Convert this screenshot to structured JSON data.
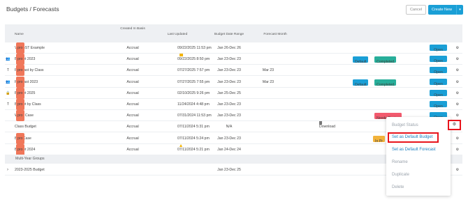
{
  "page": {
    "title": "Budgets / Forecasts",
    "cancel_label": "Cancel",
    "create_label": "Create New",
    "create_caret": "▾"
  },
  "columns": {
    "name": "Name",
    "basis": "Created In Basis",
    "updated": "Last Updated",
    "range": "Budget Date Range",
    "forecast": "Forecast Month"
  },
  "pro_label": "pro",
  "open_label": "Open",
  "gear_glyph": "⚙",
  "download_label": "Download",
  "rows": [
    {
      "name": "VAT/GST Example",
      "pro": true,
      "basis": "Accrual",
      "updated": "09/22/2025 11:53 pm",
      "range": "Jan 26-Dec 26",
      "forecast": "",
      "icon": ""
    },
    {
      "name": "Budget 2023",
      "pro": true,
      "basis": "Accrual",
      "updated": "09/22/2025 8:50 pm",
      "range": "Jan 23-Dec 23",
      "forecast": "",
      "icon": "people-icon",
      "badges": [
        "Default",
        "Completed"
      ]
    },
    {
      "name": "Forecast by Class",
      "pro": true,
      "basis": "Accrual",
      "updated": "07/27/2025 7:57 pm",
      "range": "Jan 23-Dec 23",
      "forecast": "Mar 23",
      "icon": "class-icon"
    },
    {
      "name": "Forecast 2023",
      "pro": true,
      "basis": "Accrual",
      "updated": "07/27/2025 7:55 pm",
      "range": "Jan 23-Dec 23",
      "forecast": "Mar 23",
      "icon": "people-icon",
      "badges": [
        "Default",
        "Completed"
      ]
    },
    {
      "name": "Budget 2025",
      "pro": true,
      "basis": "Accrual",
      "updated": "02/10/2025 9:26 pm",
      "range": "Jan 25-Dec 25",
      "forecast": "",
      "icon": "lock-icon"
    },
    {
      "name": "Budget by Class",
      "pro": true,
      "basis": "Accrual",
      "updated": "11/24/2024 4:48 pm",
      "range": "Jan 23-Dec 23",
      "forecast": "",
      "icon": "class-icon"
    },
    {
      "name": "Worst Case",
      "pro": true,
      "basis": "Accrual",
      "updated": "07/31/2024 11:53 pm",
      "range": "Jan 23-Dec 23",
      "forecast": "",
      "icon": "",
      "badges": [
        "Needs Review"
      ]
    },
    {
      "name": "Class Budget",
      "pro": false,
      "basis": "Accrual",
      "updated": "07/11/2024 5:31 pm",
      "range": "N/A",
      "forecast": "",
      "icon": ""
    },
    {
      "name": "Best Case",
      "pro": true,
      "basis": "Accrual",
      "updated": "07/11/2024 5:24 pm",
      "range": "Jan 23-Dec 23",
      "forecast": "",
      "icon": "",
      "badges": [
        "In Pr"
      ]
    },
    {
      "name": "Budget 2024",
      "pro": true,
      "basis": "Accrual",
      "updated": "07/11/2024 5:21 pm",
      "range": "Jan 24-Dec 24",
      "forecast": "",
      "icon": ""
    }
  ],
  "group": {
    "label": "Multi-Year Groups",
    "row": {
      "name": "2023-2025 Budget",
      "range": "Jan 23-Dec 25",
      "chevron": "›"
    }
  },
  "menu": {
    "status": "Budget Status",
    "set_default_budget": "Set as Default Budget",
    "set_default_forecast": "Set as Default Forecast",
    "rename": "Rename",
    "duplicate": "Duplicate",
    "delete": "Delete"
  },
  "colors": {
    "accent": "#1a9fd6",
    "pro": "#f0775a",
    "completed": "#27ae9a",
    "needs_review": "#f35a6e",
    "in_progress": "#f2b33b",
    "highlight": "#e8141c"
  }
}
